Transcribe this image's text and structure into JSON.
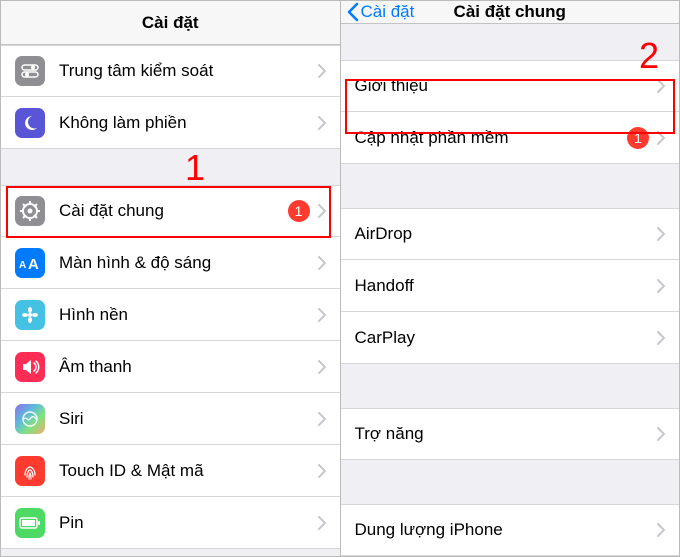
{
  "annot": {
    "one": "1",
    "two": "2"
  },
  "left": {
    "title": "Cài đặt",
    "rows": {
      "controlCenter": "Trung tâm kiểm soát",
      "dnd": "Không làm phiền",
      "general": "Cài đặt chung",
      "generalBadge": "1",
      "display": "Màn hình & độ sáng",
      "wallpaper": "Hình nền",
      "sound": "Âm thanh",
      "siri": "Siri",
      "touchid": "Touch ID & Mật mã",
      "battery": "Pin"
    }
  },
  "right": {
    "back": "Cài đặt",
    "title": "Cài đặt chung",
    "rows": {
      "about": "Giới thiệu",
      "softwareUpdate": "Cập nhật phần mềm",
      "softwareBadge": "1",
      "airdrop": "AirDrop",
      "handoff": "Handoff",
      "carplay": "CarPlay",
      "accessibility": "Trợ năng",
      "storage": "Dung lượng iPhone"
    }
  }
}
